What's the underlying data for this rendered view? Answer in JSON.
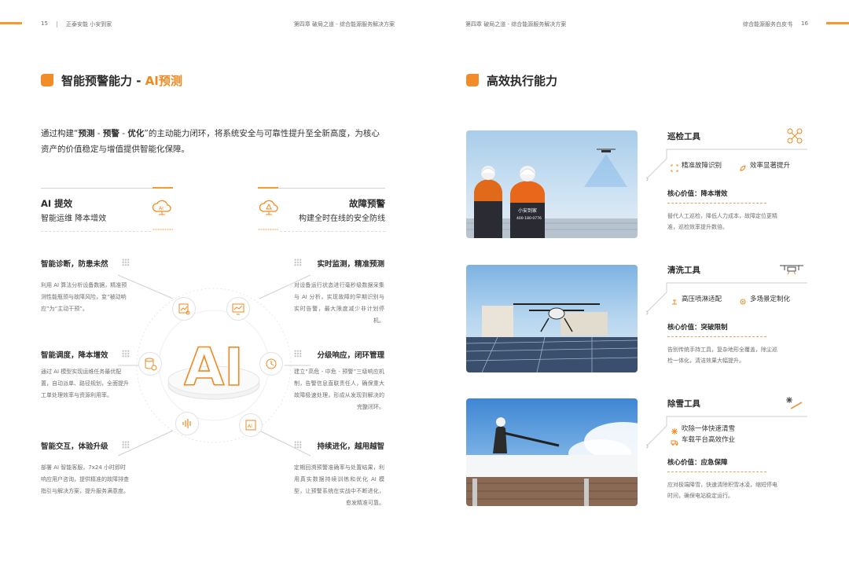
{
  "left": {
    "page_number": "15",
    "header_brand": "正泰安能 小安到家",
    "header_chapter": "第四章 破局之道 - 综合能源服务解决方案",
    "title_prefix": "智能预警能力 - ",
    "title_accent": "AI预测",
    "intro": {
      "pre": "通过构建“",
      "k1": "预测",
      "s1": " - ",
      "k2": "预警",
      "s2": " - ",
      "k3": "优化",
      "post": "”的主动能力闭环，将系统安全与可靠性提升至全新高度，为核心资产的价值稳定与增值提供智能化保障。"
    },
    "card_ai": {
      "heading": "AI 提效",
      "sub": "智能运维  降本增效",
      "icon": "ai-cloud-icon"
    },
    "card_warn": {
      "heading": "故障预警",
      "sub": "构建全时在线的安全防线",
      "icon": "warning-cloud-icon"
    },
    "center_label": "AI",
    "features": [
      {
        "title": "智能诊断，防患未然",
        "body": "利用 AI 算法分析设备数据，精准预测性能瓶颈与故障风险，变“被动响应”为“主动干预”。"
      },
      {
        "title": "实时监测，精准预测",
        "body": "对设备运行状态进行毫秒级数据采集与 AI 分析，实现故障的早期识别与实时告警，最大限度减少非计划停机。"
      },
      {
        "title": "智能调度，降本增效",
        "body": "通过 AI 模型实现运维任务最优配置，自动派单、路径规划，全面提升工单处理效率与资源利用率。"
      },
      {
        "title": "分级响应，闭环管理",
        "body": "建立“高危 - 中危 - 预警”三级响应机制，告警信息直联责任人，确保重大故障极速处理，形成从发现到解决的完整闭环。"
      },
      {
        "title": "智能交互，体验升级",
        "body": "部署 AI 智能客服，7x24 小时即时响应用户咨询，提供精准的故障排查指引与解决方案，提升服务满意度。"
      },
      {
        "title": "持续进化，越用越智",
        "body": "定期回溯预警准确率与处置结果，利用真实数据持续训练和优化 AI 模型，让预警系统在实战中不断进化，愈发精准可靠。"
      }
    ],
    "ring_icons": [
      "chart-search-icon",
      "monitor-chart-icon",
      "database-gear-icon",
      "alarm-icon",
      "voice-wave-icon",
      "ai-chip-icon"
    ]
  },
  "right": {
    "page_number": "16",
    "header_chapter": "第四章 破局之道 - 综合能源服务解决方案",
    "header_doc": "综合能源服务白皮书",
    "title": "高效执行能力",
    "photo1_vest_text": "小安到家",
    "photo1_phone": "400-180-0776",
    "tools": [
      {
        "title": "巡检工具",
        "icon": "drone-icon",
        "tags": [
          {
            "icon": "scan-icon",
            "text": "精准故障识别"
          },
          {
            "icon": "rocket-icon",
            "text": "效率显著提升"
          }
        ],
        "core": "核心价值：降本增效",
        "desc": "替代人工巡检，降低人力成本，故障定位更精准，巡检效率提升数倍。"
      },
      {
        "title": "清洗工具",
        "icon": "spray-drone-icon",
        "tags": [
          {
            "icon": "spray-icon",
            "text": "高压喷淋适配"
          },
          {
            "icon": "gear-icon",
            "text": "多场景定制化"
          }
        ],
        "core": "核心价值：突破限制",
        "desc": "告别传统手持工具，复杂地形全覆盖，除尘巡检一体化，清洁效果大幅提升。"
      },
      {
        "title": "除雪工具",
        "icon": "snow-brush-icon",
        "tags": [
          {
            "icon": "snowflake-icon",
            "text": "吹除一体快速清雪"
          },
          {
            "icon": "truck-icon",
            "text": "车载平台高效作业"
          }
        ],
        "core": "核心价值：应急保障",
        "desc": "应对极端降雪，快速清除积雪冰凌，缩短停电时间，确保电站稳定运行。"
      }
    ]
  }
}
